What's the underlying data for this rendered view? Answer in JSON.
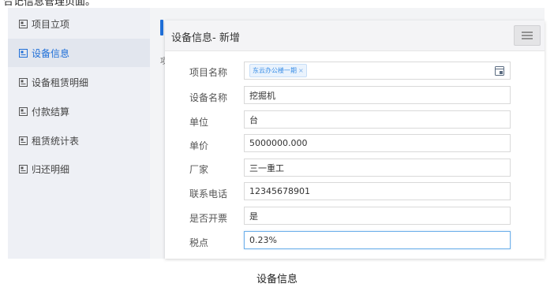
{
  "top_fragment": "合记信息管理页面。",
  "sidebar": {
    "items": [
      {
        "label": "项目立项",
        "active": false
      },
      {
        "label": "设备信息",
        "active": true
      },
      {
        "label": "设备租赁明细",
        "active": false
      },
      {
        "label": "付款结算",
        "active": false
      },
      {
        "label": "租赁统计表",
        "active": false
      },
      {
        "label": "归还明细",
        "active": false
      }
    ]
  },
  "background": {
    "fragment": "项"
  },
  "dialog": {
    "title": "设备信息- 新增",
    "fields": [
      {
        "label": "项目名称",
        "tag": "东云办公楼一期",
        "tag_remove": "×"
      },
      {
        "label": "设备名称",
        "value": "挖掘机"
      },
      {
        "label": "单位",
        "value": "台"
      },
      {
        "label": "单价",
        "value": "5000000.000"
      },
      {
        "label": "厂家",
        "value": "三一重工"
      },
      {
        "label": "联系电话",
        "value": "12345678901"
      },
      {
        "label": "是否开票",
        "value": "是"
      },
      {
        "label": "税点",
        "value": "0.23%"
      }
    ]
  },
  "caption": "设备信息",
  "colors": {
    "accent": "#1f6fd8",
    "tag_text": "#3a8ee6",
    "sidebar_bg": "#eef0f5"
  }
}
